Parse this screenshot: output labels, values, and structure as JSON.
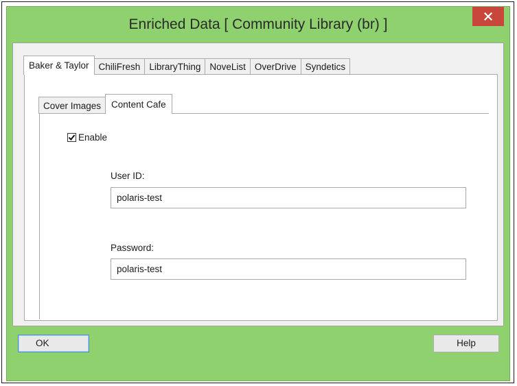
{
  "window": {
    "title": "Enriched Data [ Community Library  (br) ]",
    "close_icon": "close-icon"
  },
  "outer_tabs": [
    {
      "label": "Baker & Taylor",
      "active": true
    },
    {
      "label": "ChiliFresh",
      "active": false
    },
    {
      "label": "LibraryThing",
      "active": false
    },
    {
      "label": "NoveList",
      "active": false
    },
    {
      "label": "OverDrive",
      "active": false
    },
    {
      "label": "Syndetics",
      "active": false
    }
  ],
  "inner_tabs": [
    {
      "label": "Cover Images",
      "active": false
    },
    {
      "label": "Content Cafe",
      "active": true
    }
  ],
  "enable": {
    "label": "Enable",
    "checked": true
  },
  "user_id": {
    "label": "User ID:",
    "value": "polaris-test"
  },
  "password": {
    "label": "Password:",
    "value": "polaris-test"
  },
  "buttons": {
    "ok": "OK",
    "help": "Help"
  },
  "colors": {
    "title_bar": "#8fd16e",
    "close_button": "#c9463d"
  }
}
